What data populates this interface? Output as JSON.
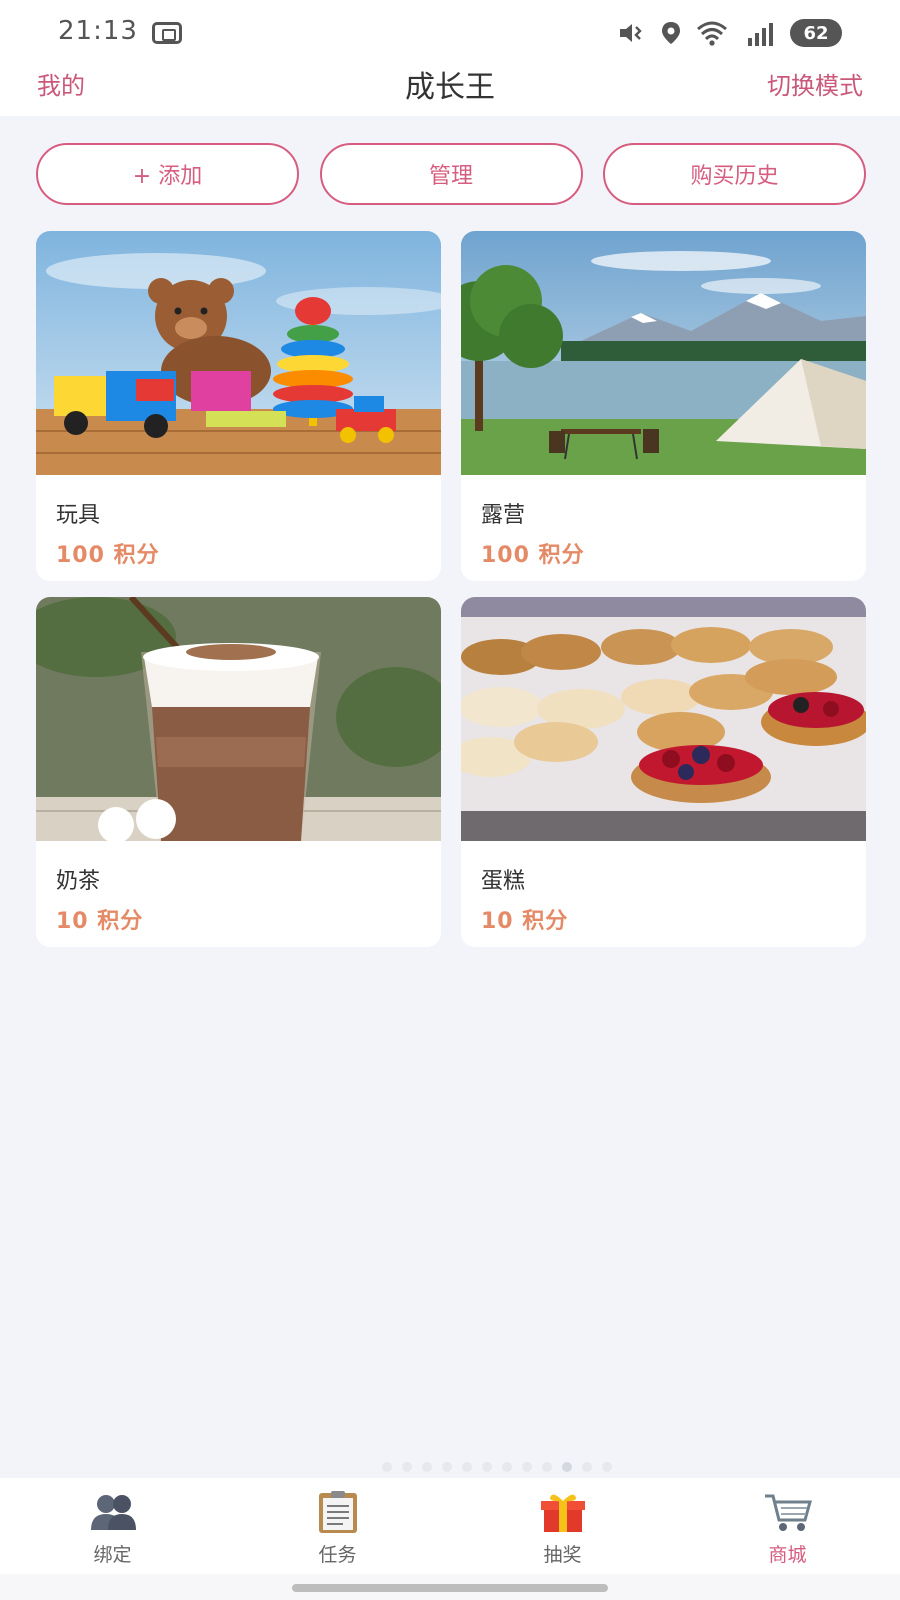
{
  "status_bar": {
    "time": "21:13",
    "battery": "62",
    "icons": [
      "screenshot-icon",
      "mute-vibrate-icon",
      "location-icon",
      "wifi-icon",
      "cellular-signal-icon",
      "battery-icon"
    ]
  },
  "header": {
    "left": "我的",
    "title": "成长王",
    "right": "切换模式",
    "accent_color": "#c9587a"
  },
  "actions": {
    "add": "+ 添加",
    "manage": "管理",
    "history": "购买历史"
  },
  "products": [
    {
      "name": "玩具",
      "price": "100 积分",
      "image": "toys-image"
    },
    {
      "name": "露营",
      "price": "100 积分",
      "image": "camping-image"
    },
    {
      "name": "奶茶",
      "price": "10 积分",
      "image": "milk-tea-image"
    },
    {
      "name": "蛋糕",
      "price": "10 积分",
      "image": "cake-image"
    }
  ],
  "price_color": "#e58a66",
  "nav": {
    "items": [
      {
        "label": "绑定",
        "icon": "users-icon"
      },
      {
        "label": "任务",
        "icon": "clipboard-icon"
      },
      {
        "label": "抽奖",
        "icon": "gift-icon"
      },
      {
        "label": "商城",
        "icon": "shopping-cart-icon"
      }
    ],
    "active": "商城",
    "active_color": "#d65d80"
  }
}
